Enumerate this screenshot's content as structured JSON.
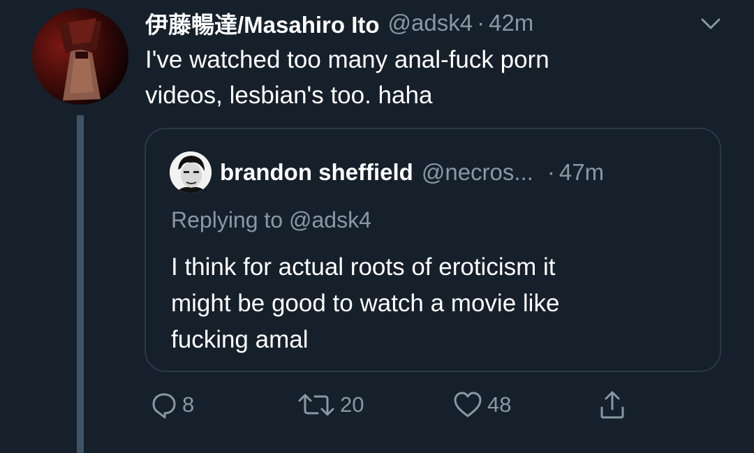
{
  "tweet": {
    "author_name": "伊藤暢達/Masahiro Ito",
    "handle": "@adsk4",
    "separator": "·",
    "timestamp": "42m",
    "text_lines": [
      "I've watched too many anal-fuck porn",
      "videos, lesbian's too. haha"
    ]
  },
  "quoted_tweet": {
    "author_name": "brandon sheffield",
    "handle": "@necros...",
    "separator": "·",
    "timestamp": "47m",
    "replying_to": "Replying to @adsk4",
    "text_lines": [
      "I think for actual roots of eroticism it",
      "might be good to watch a movie like",
      "fucking amal"
    ]
  },
  "actions": {
    "reply_count": "8",
    "retweet_count": "20",
    "like_count": "48"
  },
  "icons": {
    "more": "chevron-down-icon",
    "reply": "reply-icon",
    "retweet": "retweet-icon",
    "like": "heart-icon",
    "share": "share-icon"
  },
  "colors": {
    "background": "#15202b",
    "primary_text": "#ffffff",
    "secondary_text": "#8899a6",
    "border": "#2a3947",
    "thread_line": "#3d5466"
  }
}
